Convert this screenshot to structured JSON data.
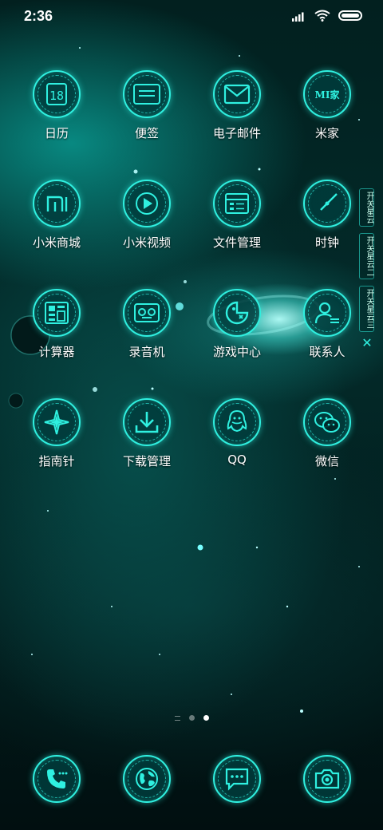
{
  "status_bar": {
    "time": "2:36"
  },
  "apps": [
    {
      "label": "日历",
      "icon": "calendar-icon",
      "day": "18"
    },
    {
      "label": "便签",
      "icon": "notes-icon"
    },
    {
      "label": "电子邮件",
      "icon": "mail-icon"
    },
    {
      "label": "米家",
      "icon": "mijia-icon",
      "text": "MI家"
    },
    {
      "label": "小米商城",
      "icon": "mi-store-icon"
    },
    {
      "label": "小米视频",
      "icon": "video-icon"
    },
    {
      "label": "文件管理",
      "icon": "folder-icon"
    },
    {
      "label": "时钟",
      "icon": "clock-icon"
    },
    {
      "label": "计算器",
      "icon": "calculator-icon"
    },
    {
      "label": "录音机",
      "icon": "recorder-icon"
    },
    {
      "label": "游戏中心",
      "icon": "game-icon"
    },
    {
      "label": "联系人",
      "icon": "contacts-icon"
    },
    {
      "label": "指南针",
      "icon": "compass-icon"
    },
    {
      "label": "下载管理",
      "icon": "download-icon"
    },
    {
      "label": "QQ",
      "icon": "qq-icon"
    },
    {
      "label": "微信",
      "icon": "wechat-icon"
    }
  ],
  "side_panel": {
    "tabs": [
      "开关星云",
      "开关星云二",
      "开关星云三"
    ],
    "close": "✕"
  },
  "pager": {
    "pages": 3,
    "current": 3
  },
  "dock": [
    {
      "icon": "phone-icon"
    },
    {
      "icon": "browser-icon"
    },
    {
      "icon": "messages-icon"
    },
    {
      "icon": "camera-icon"
    }
  ],
  "colors": {
    "accent": "#2ff0e0",
    "background": "#02201f"
  }
}
